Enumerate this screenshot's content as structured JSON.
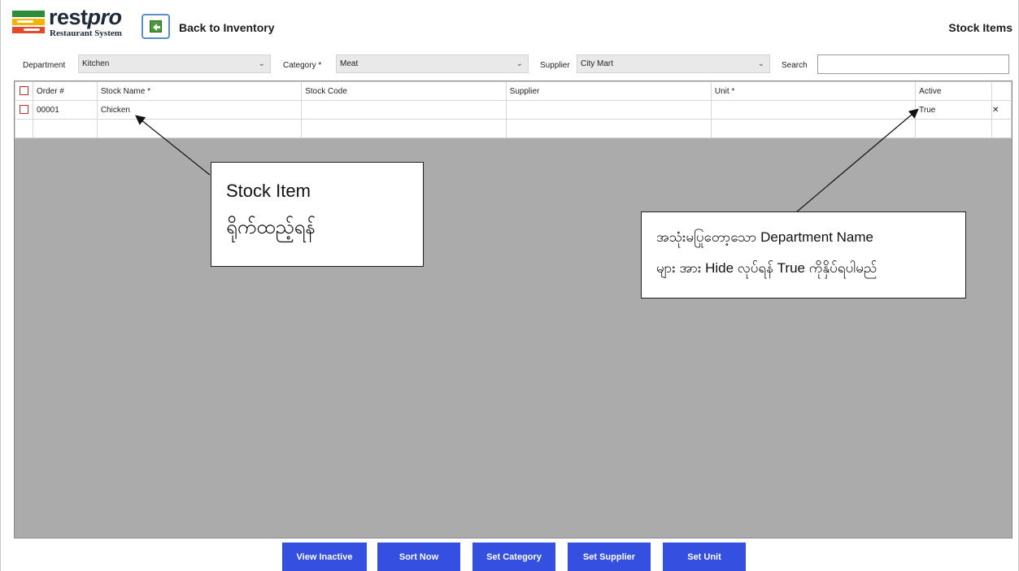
{
  "header": {
    "logo_text_main": "rest",
    "logo_text_italic": "pro",
    "logo_subtitle": "Restaurant System",
    "back_label": "Back to Inventory",
    "page_title": "Stock Items"
  },
  "filters": {
    "department": {
      "label": "Department",
      "value": "Kitchen"
    },
    "category": {
      "label": "Category *",
      "value": "Meat"
    },
    "supplier": {
      "label": "Supplier",
      "value": "City Mart"
    },
    "search": {
      "label": "Search",
      "value": ""
    }
  },
  "grid": {
    "columns": [
      "Order #",
      "Stock Name *",
      "Stock Code",
      "Supplier",
      "Unit *",
      "Active"
    ],
    "rows": [
      {
        "order": "00001",
        "stock_name": "Chicken",
        "stock_code": "",
        "supplier": "",
        "unit": "",
        "active": "True"
      }
    ],
    "delete_glyph": "✕"
  },
  "callouts": {
    "stock_item": {
      "line1": "Stock Item",
      "line2": "ရိုက်ထည့်ရန်"
    },
    "active": {
      "line1": "အသုံးမပြုတော့သော Department Name",
      "line2": "များ အား Hide လုပ်ရန် True ကိုနှိပ်ရပါမည်"
    }
  },
  "footer": {
    "buttons": [
      "View Inactive",
      "Sort Now",
      "Set Category",
      "Set Supplier",
      "Set Unit"
    ]
  },
  "colors": {
    "button_bg": "#3550e0",
    "grid_empty_bg": "#ababab",
    "delete_red": "#c41414",
    "checkbox_red": "#c62b2b"
  },
  "icons": {
    "back": "back-arrow-icon",
    "dropdown": "chevron-down-icon",
    "delete": "delete-x-icon",
    "checkbox": "checkbox-icon"
  }
}
